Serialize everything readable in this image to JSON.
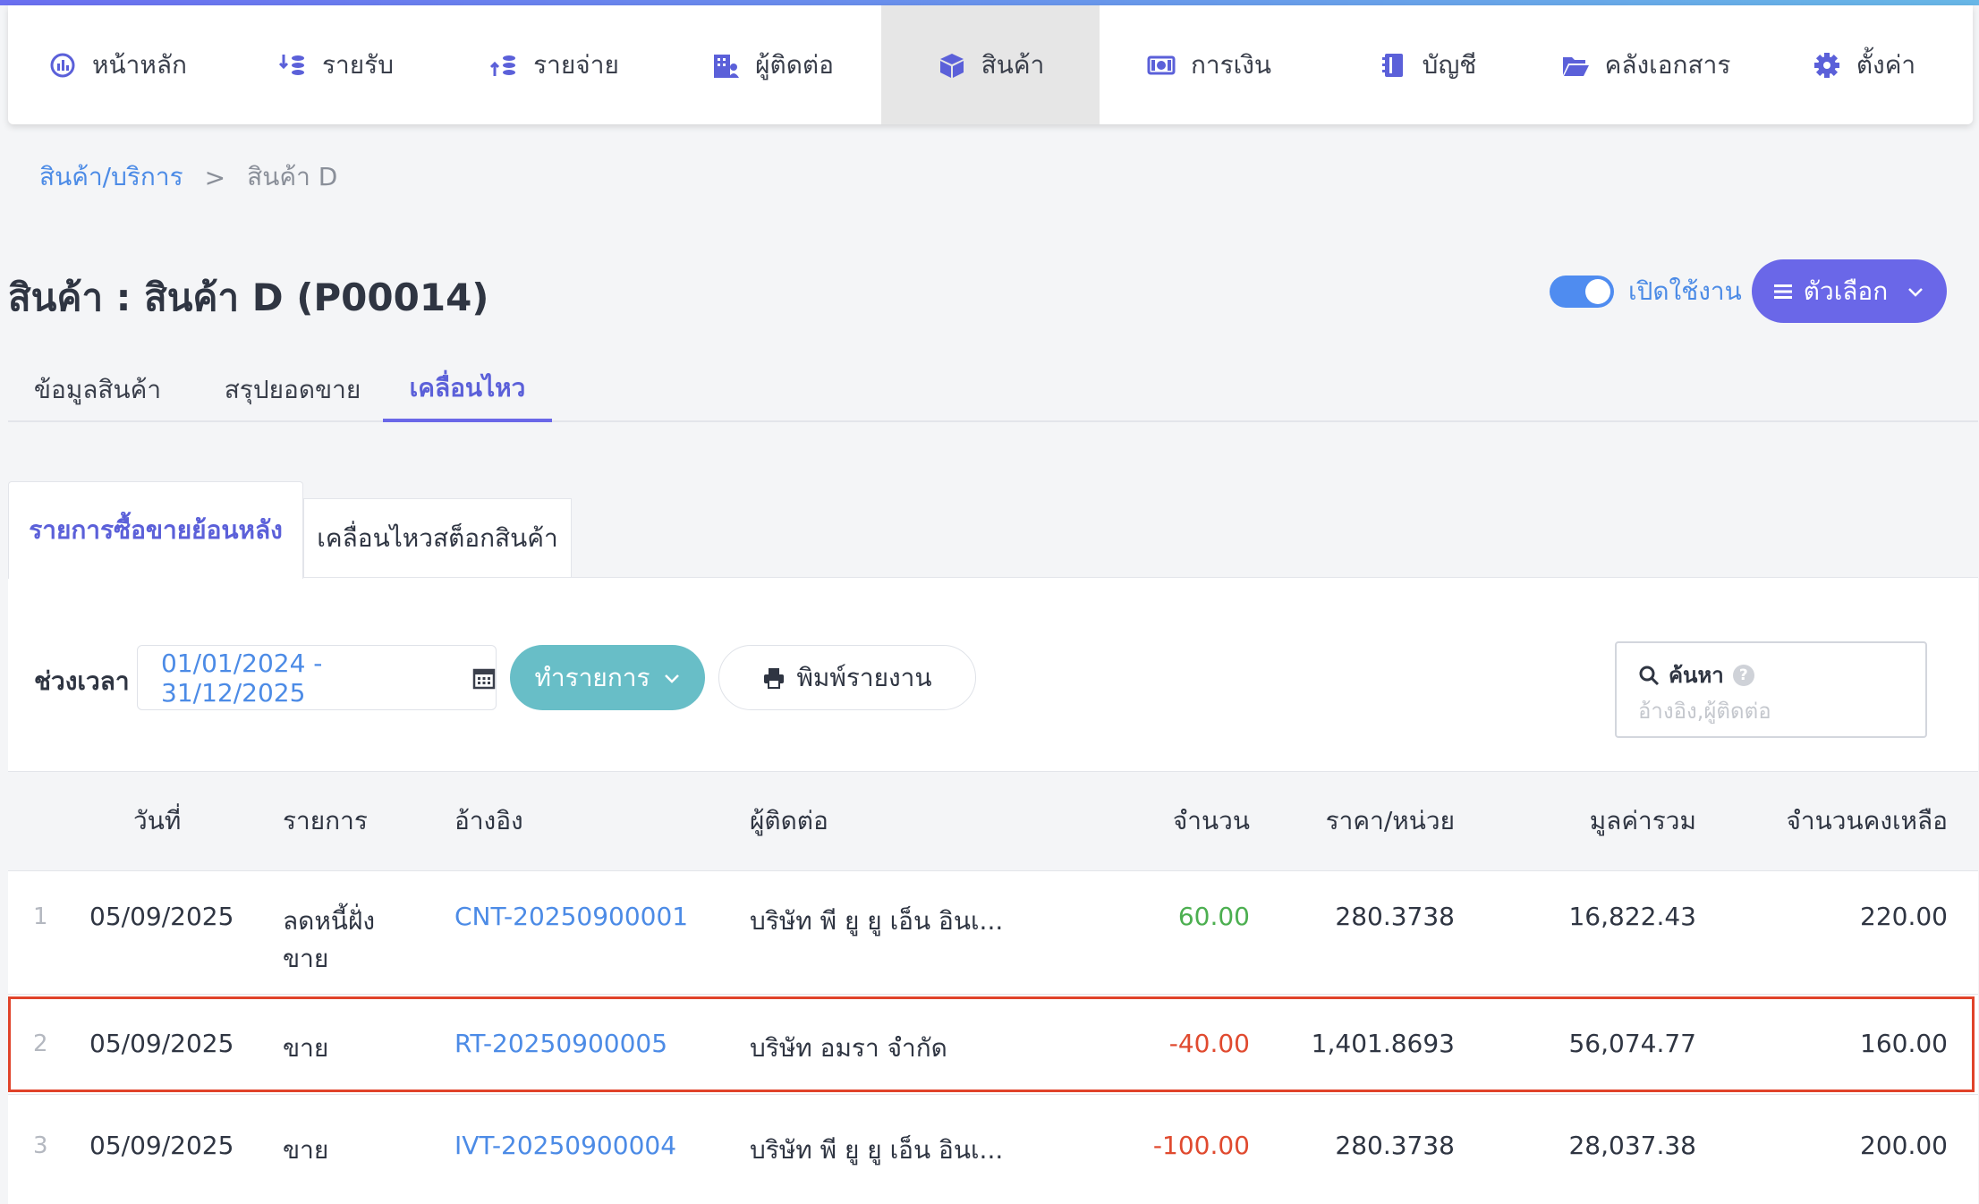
{
  "nav": {
    "items": [
      {
        "label": "หน้าหลัก",
        "icon": "dashboard-icon",
        "active": false
      },
      {
        "label": "รายรับ",
        "icon": "income-icon",
        "active": false
      },
      {
        "label": "รายจ่าย",
        "icon": "expense-icon",
        "active": false
      },
      {
        "label": "ผู้ติดต่อ",
        "icon": "contacts-icon",
        "active": false
      },
      {
        "label": "สินค้า",
        "icon": "box-icon",
        "active": true
      },
      {
        "label": "การเงิน",
        "icon": "money-icon",
        "active": false
      },
      {
        "label": "บัญชี",
        "icon": "ledger-icon",
        "active": false
      },
      {
        "label": "คลังเอกสาร",
        "icon": "folder-icon",
        "active": false
      },
      {
        "label": "ตั้งค่า",
        "icon": "gear-icon",
        "active": false
      }
    ]
  },
  "breadcrumb": {
    "parent": "สินค้า/บริการ",
    "separator": ">",
    "current": "สินค้า D"
  },
  "page": {
    "title": "สินค้า : สินค้า D (P00014)"
  },
  "status": {
    "toggle_label": "เปิดใช้งาน",
    "enabled": true
  },
  "options_button": {
    "label": "ตัวเลือก"
  },
  "tabs": [
    {
      "label": "ข้อมูลสินค้า",
      "active": false
    },
    {
      "label": "สรุปยอดขาย",
      "active": false
    },
    {
      "label": "เคลื่อนไหว",
      "active": true
    }
  ],
  "subtabs": [
    {
      "label": "รายการซื้อขายย้อนหลัง",
      "active": true
    },
    {
      "label": "เคลื่อนไหวสต็อกสินค้า",
      "active": false
    }
  ],
  "filters": {
    "period_label": "ช่วงเวลา",
    "date_range": "01/01/2024 - 31/12/2025",
    "action_button": "ทำรายการ",
    "print_button": "พิมพ์รายงาน",
    "search_label": "ค้นหา",
    "search_placeholder": "อ้างอิง,ผู้ติดต่อ"
  },
  "table": {
    "columns": [
      "วันที่",
      "รายการ",
      "อ้างอิง",
      "ผู้ติดต่อ",
      "จำนวน",
      "ราคา/หน่วย",
      "มูลค่ารวม",
      "จำนวนคงเหลือ"
    ],
    "rows": [
      {
        "index": "1",
        "date": "05/09/2025",
        "type_line1": "ลดหนี้ฝั่ง",
        "type_line2": "ขาย",
        "ref": "CNT-20250900001",
        "contact": "บริษัท พี ยู ยู เอ็น อินเ...",
        "qty": "60.00",
        "qty_sign": "positive",
        "unit_price": "280.3738",
        "total": "16,822.43",
        "balance": "220.00"
      },
      {
        "index": "2",
        "date": "05/09/2025",
        "type_line1": "ขาย",
        "type_line2": "",
        "ref": "RT-20250900005",
        "contact": "บริษัท อมรา จำกัด",
        "qty": "-40.00",
        "qty_sign": "negative",
        "unit_price": "1,401.8693",
        "total": "56,074.77",
        "balance": "160.00",
        "highlighted": true
      },
      {
        "index": "3",
        "date": "05/09/2025",
        "type_line1": "ขาย",
        "type_line2": "",
        "ref": "IVT-20250900004",
        "contact": "บริษัท พี ยู ยู เอ็น อินเ...",
        "qty": "-100.00",
        "qty_sign": "negative",
        "unit_price": "280.3738",
        "total": "28,037.38",
        "balance": "200.00"
      }
    ]
  },
  "colors": {
    "accent": "#6a67e8",
    "link": "#4c8be6",
    "teal": "#68bec7",
    "positive": "#4caf50",
    "negative": "#e04a2f",
    "highlight": "#e0432a"
  }
}
